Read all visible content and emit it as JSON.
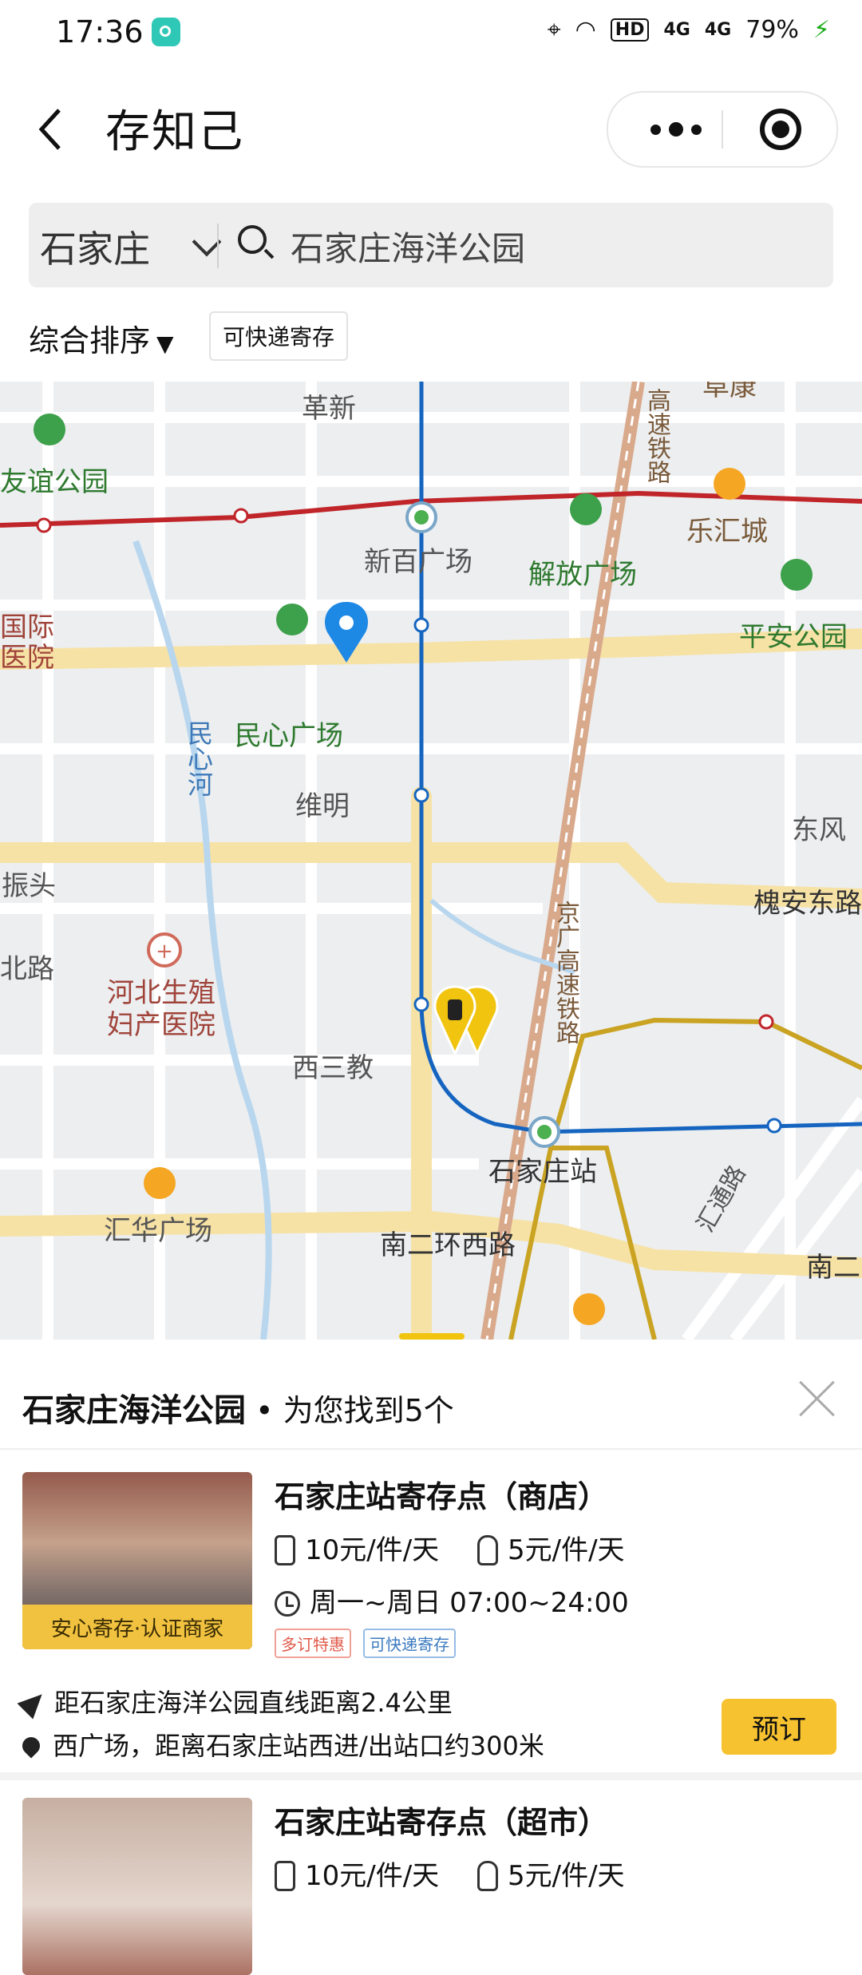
{
  "status_bar": {
    "time": "17:36",
    "network": "HD",
    "signal_1": "4G",
    "signal_2": "4G",
    "battery": "79%"
  },
  "header": {
    "title": "存知己"
  },
  "search": {
    "city": "石家庄",
    "query": "石家庄海洋公园"
  },
  "filters": {
    "sort_label": "综合排序",
    "chip_label": "可快递寄存"
  },
  "map": {
    "labels": {
      "gexin": "革新",
      "youyi_park": "友谊公园",
      "xinbai_square": "新百广场",
      "jiefang_square": "解放广场",
      "lehui_city": "乐汇城",
      "intl_hospital_1": "国际",
      "intl_hospital_2": "医院",
      "pingan_park": "平安公园",
      "minxin_square": "民心广场",
      "minxin_river": "民心河",
      "weiming": "维明",
      "dongfeng": "东风",
      "zhentou": "振头",
      "huaian_east_rd": "槐安东路",
      "bei_rd": "北路",
      "hebei_hospital": "河北生殖妇产医院",
      "jingguang_rail": "京广高速铁路",
      "xisanjiao": "西三教",
      "sjz_station": "石家庄站",
      "huihua_square": "汇华广场",
      "nan_erhuan_west": "南二环西路",
      "hui_tong_rd": "汇通路",
      "nan_er": "南二",
      "gaosu_rail_top": "高速铁路",
      "fukang": "阜康"
    }
  },
  "results": {
    "keyword": "石家庄海洋公园",
    "summary": "为您找到5个"
  },
  "cards": [
    {
      "name": "石家庄站寄存点（商店）",
      "badge": "安心寄存·认证商家",
      "price_luggage": "10元/件/天",
      "price_bag": "5元/件/天",
      "hours": "周一~周日 07:00~24:00",
      "tag_1": "多订特惠",
      "tag_2": "可快递寄存",
      "distance": "距石家庄海洋公园直线距离2.4公里",
      "address": "西广场，距离石家庄站西进/出站口约300米",
      "book_label": "预订"
    },
    {
      "name": "石家庄站寄存点（超市）",
      "price_luggage": "10元/件/天",
      "price_bag": "5元/件/天"
    }
  ],
  "colors": {
    "accent": "#f6c230",
    "metro_line": "#1565c0",
    "red_line": "#c0252a"
  }
}
